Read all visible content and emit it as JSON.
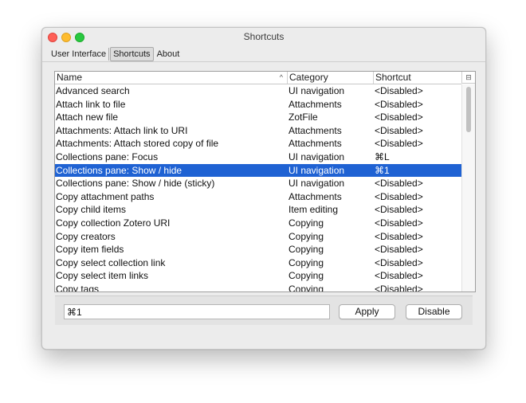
{
  "window": {
    "title": "Shortcuts"
  },
  "tabs": [
    {
      "label": "User Interface",
      "selected": false
    },
    {
      "label": "Shortcuts",
      "selected": true
    },
    {
      "label": "About",
      "selected": false
    }
  ],
  "table": {
    "columns": {
      "name": "Name",
      "category": "Category",
      "shortcut": "Shortcut"
    },
    "sort_icon": "sort-ascending-icon",
    "corner_icon": "column-chooser-icon",
    "rows": [
      {
        "name": "Advanced search",
        "category": "UI navigation",
        "shortcut": "<Disabled>"
      },
      {
        "name": "Attach link to file",
        "category": "Attachments",
        "shortcut": "<Disabled>"
      },
      {
        "name": "Attach new file",
        "category": "ZotFile",
        "shortcut": "<Disabled>"
      },
      {
        "name": "Attachments: Attach link to URI",
        "category": "Attachments",
        "shortcut": "<Disabled>"
      },
      {
        "name": "Attachments: Attach stored copy of file",
        "category": "Attachments",
        "shortcut": "<Disabled>"
      },
      {
        "name": "Collections pane: Focus",
        "category": "UI navigation",
        "shortcut": "⌘L"
      },
      {
        "name": "Collections pane: Show / hide",
        "category": "UI navigation",
        "shortcut": "⌘1",
        "selected": true
      },
      {
        "name": "Collections pane: Show / hide (sticky)",
        "category": "UI navigation",
        "shortcut": "<Disabled>"
      },
      {
        "name": "Copy attachment paths",
        "category": "Attachments",
        "shortcut": "<Disabled>"
      },
      {
        "name": "Copy child items",
        "category": "Item editing",
        "shortcut": "<Disabled>"
      },
      {
        "name": "Copy collection Zotero URI",
        "category": "Copying",
        "shortcut": "<Disabled>"
      },
      {
        "name": "Copy creators",
        "category": "Copying",
        "shortcut": "<Disabled>"
      },
      {
        "name": "Copy item fields",
        "category": "Copying",
        "shortcut": "<Disabled>"
      },
      {
        "name": "Copy select collection link",
        "category": "Copying",
        "shortcut": "<Disabled>"
      },
      {
        "name": "Copy select item links",
        "category": "Copying",
        "shortcut": "<Disabled>"
      },
      {
        "name": "Copy tags",
        "category": "Copying",
        "shortcut": "<Disabled>"
      }
    ]
  },
  "editor": {
    "shortcut_value": "⌘1",
    "apply_label": "Apply",
    "disable_label": "Disable"
  },
  "colors": {
    "selection": "#1f62d3",
    "close": "#fe5f57",
    "minimize": "#febc2e",
    "zoom": "#28c840"
  }
}
